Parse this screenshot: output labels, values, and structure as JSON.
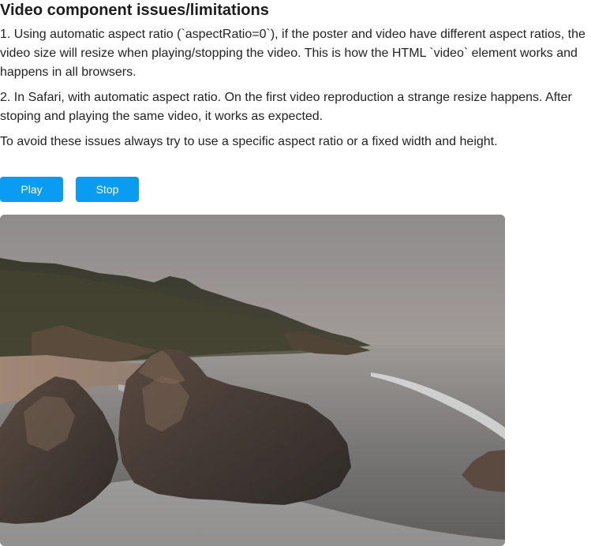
{
  "page": {
    "title": "Video component issues/limitations",
    "paragraphs": [
      "1. Using automatic aspect ratio (`aspectRatio=0`), if the poster and video have different aspect ratios, the video size will resize when playing/stopping the video. This is how the HTML `video` element works and happens in all browsers.",
      "2. In Safari, with automatic aspect ratio. On the first video reproduction a strange resize happens. After stoping and playing the same video, it works as expected.",
      "To avoid these issues always try to use a specific aspect ratio or a fixed width and height."
    ]
  },
  "controls": {
    "play_label": "Play",
    "stop_label": "Stop"
  },
  "video": {
    "poster_subject": "coastal sunset with rocky shore and waves",
    "state": "stopped"
  },
  "colors": {
    "button_bg": "#0a9cf0",
    "button_text": "#ffffff",
    "heading_text": "#1c1c1c",
    "body_text": "#232323"
  }
}
